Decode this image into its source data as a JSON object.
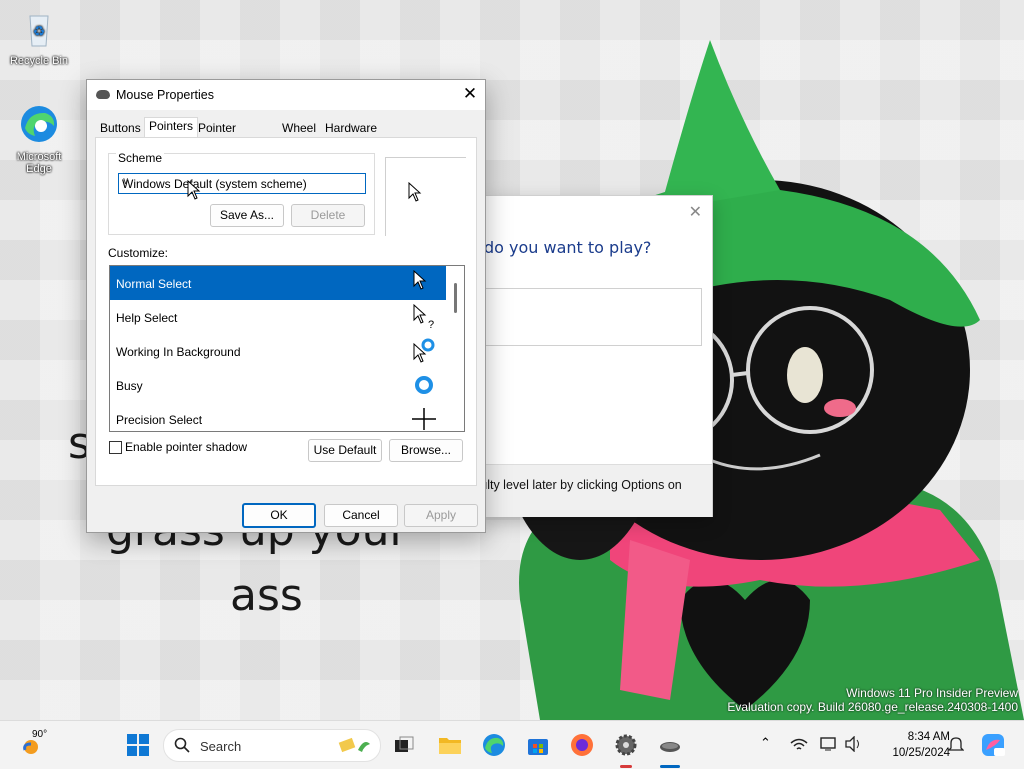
{
  "desktop": {
    "icons": [
      {
        "label": "Recycle Bin"
      },
      {
        "label": "Microsoft Edge"
      }
    ],
    "wallpaper_text": [
      "s",
      "grass up your",
      "ass"
    ],
    "watermark": {
      "line1": "Windows 11 Pro Insider Preview",
      "line2": "Evaluation copy. Build 26080.ge_release.240308-1400"
    }
  },
  "game_dialog": {
    "question": "do you want to play?",
    "hint": "culty level later by clicking Options on",
    "close": "✕"
  },
  "mouse_dialog": {
    "title": "Mouse Properties",
    "close": "✕",
    "tabs": [
      {
        "label": "Buttons"
      },
      {
        "label": "Pointers"
      },
      {
        "label": "Pointer Options"
      },
      {
        "label": "Wheel"
      },
      {
        "label": "Hardware"
      }
    ],
    "active_tab": "Pointers",
    "scheme": {
      "label": "Scheme",
      "value": "Windows Default (system scheme)",
      "save_as": "Save As...",
      "delete": "Delete"
    },
    "customize": {
      "label": "Customize:",
      "items": [
        {
          "label": "Normal Select",
          "cursor": "arrow-cursor-icon",
          "selected": true
        },
        {
          "label": "Help Select",
          "cursor": "help-cursor-icon",
          "selected": false
        },
        {
          "label": "Working In Background",
          "cursor": "working-cursor-icon",
          "selected": false
        },
        {
          "label": "Busy",
          "cursor": "busy-cursor-icon",
          "selected": false
        },
        {
          "label": "Precision Select",
          "cursor": "crosshair-cursor-icon",
          "selected": false
        }
      ]
    },
    "enable_shadow": "Enable pointer shadow",
    "use_default": "Use Default",
    "browse": "Browse...",
    "ok": "OK",
    "cancel": "Cancel",
    "apply": "Apply",
    "accent": "#0067c0"
  },
  "taskbar": {
    "weather": "90°",
    "search_placeholder": "Search",
    "time": "8:34 AM",
    "date": "10/25/2024"
  }
}
